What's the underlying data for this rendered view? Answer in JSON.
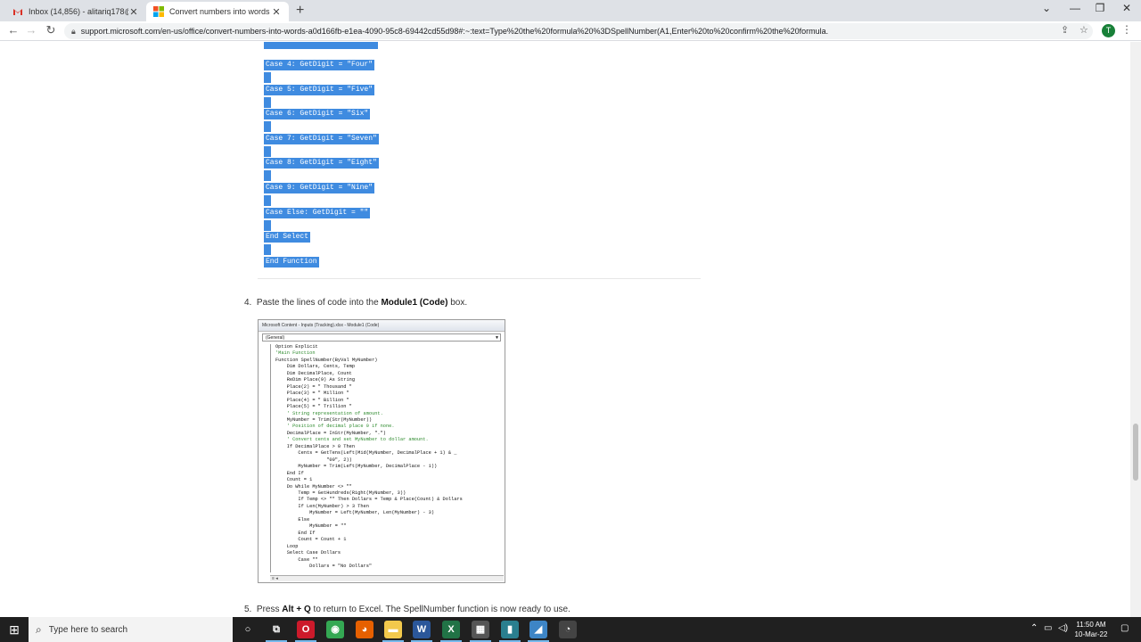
{
  "tabs": [
    {
      "title": "Inbox (14,856) - alitariq178@gm",
      "close": "✕",
      "favicon_color": "#d93025"
    },
    {
      "title": "Convert numbers into words",
      "close": "✕",
      "favicon_color": "#f25022"
    }
  ],
  "new_tab": "+",
  "window_controls": {
    "minimize": "—",
    "maximize": "❐",
    "close": "✕",
    "tab_search": "⌄"
  },
  "address_bar": {
    "url": "support.microsoft.com/en-us/office/convert-numbers-into-words-a0d166fb-e1ea-4090-95c8-69442cd55d98#:~:text=Type%20the%20formula%20%3DSpellNumber(A1,Enter%20to%20confirm%20the%20formula.",
    "profile_initial": "T"
  },
  "code_block": [
    {
      "text": "Case 4: GetDigit = \"Four\""
    },
    {
      "text": "Case 5: GetDigit = \"Five\""
    },
    {
      "text": "Case 6: GetDigit = \"Six\""
    },
    {
      "text": "Case 7: GetDigit = \"Seven\""
    },
    {
      "text": "Case 8: GetDigit = \"Eight\""
    },
    {
      "text": "Case 9: GetDigit = \"Nine\""
    },
    {
      "text": "Case Else: GetDigit = \"\""
    },
    {
      "text": "End Select"
    },
    {
      "text": "End Function"
    }
  ],
  "steps": {
    "step4": {
      "num": "4.",
      "before": "Paste the lines of code into the ",
      "bold": "Module1 (Code)",
      "after": " box."
    },
    "step5": {
      "num": "5.",
      "before": "Press ",
      "bold": "Alt + Q",
      "after": " to return to Excel. The SpellNumber function is now ready to use."
    }
  },
  "vba_window": {
    "title": "Microsoft Content - Inputs (Tracking).xlsx - Module1 (Code)",
    "combo": "(General)",
    "lines": [
      {
        "text": "Option Explicit",
        "comment": false
      },
      {
        "text": "'Main Function",
        "comment": true
      },
      {
        "text": "Function SpellNumber(ByVal MyNumber)",
        "comment": false
      },
      {
        "text": "    Dim Dollars, Cents, Temp",
        "comment": false
      },
      {
        "text": "    Dim DecimalPlace, Count",
        "comment": false
      },
      {
        "text": "    ReDim Place(9) As String",
        "comment": false
      },
      {
        "text": "    Place(2) = \" Thousand \"",
        "comment": false
      },
      {
        "text": "    Place(3) = \" Million \"",
        "comment": false
      },
      {
        "text": "    Place(4) = \" Billion \"",
        "comment": false
      },
      {
        "text": "    Place(5) = \" Trillion \"",
        "comment": false
      },
      {
        "text": "    ' String representation of amount.",
        "comment": true
      },
      {
        "text": "    MyNumber = Trim(Str(MyNumber))",
        "comment": false
      },
      {
        "text": "    ' Position of decimal place 0 if none.",
        "comment": true
      },
      {
        "text": "    DecimalPlace = InStr(MyNumber, \".\")",
        "comment": false
      },
      {
        "text": "    ' Convert cents and set MyNumber to dollar amount.",
        "comment": true
      },
      {
        "text": "    If DecimalPlace > 0 Then",
        "comment": false
      },
      {
        "text": "        Cents = GetTens(Left(Mid(MyNumber, DecimalPlace + 1) & _",
        "comment": false
      },
      {
        "text": "                  \"00\", 2))",
        "comment": false
      },
      {
        "text": "        MyNumber = Trim(Left(MyNumber, DecimalPlace - 1))",
        "comment": false
      },
      {
        "text": "    End If",
        "comment": false
      },
      {
        "text": "    Count = 1",
        "comment": false
      },
      {
        "text": "    Do While MyNumber <> \"\"",
        "comment": false
      },
      {
        "text": "        Temp = GetHundreds(Right(MyNumber, 3))",
        "comment": false
      },
      {
        "text": "        If Temp <> \"\" Then Dollars = Temp & Place(Count) & Dollars",
        "comment": false
      },
      {
        "text": "        If Len(MyNumber) > 3 Then",
        "comment": false
      },
      {
        "text": "            MyNumber = Left(MyNumber, Len(MyNumber) - 3)",
        "comment": false
      },
      {
        "text": "        Else",
        "comment": false
      },
      {
        "text": "            MyNumber = \"\"",
        "comment": false
      },
      {
        "text": "        End If",
        "comment": false
      },
      {
        "text": "        Count = Count + 1",
        "comment": false
      },
      {
        "text": "    Loop",
        "comment": false
      },
      {
        "text": "    Select Case Dollars",
        "comment": false
      },
      {
        "text": "        Case \"\"",
        "comment": false
      },
      {
        "text": "            Dollars = \"No Dollars\"",
        "comment": false
      }
    ]
  },
  "taskbar": {
    "search_placeholder": "Type here to search",
    "time": "11:50 AM",
    "date": "10-Mar-22",
    "apps": [
      {
        "name": "cortana",
        "glyph": "○",
        "color": "transparent"
      },
      {
        "name": "task-view",
        "glyph": "⧉",
        "color": "transparent"
      },
      {
        "name": "opera",
        "glyph": "O",
        "color": "#cc1a2b"
      },
      {
        "name": "chrome",
        "glyph": "◉",
        "color": "#34a853"
      },
      {
        "name": "firefox",
        "glyph": "◕",
        "color": "#e66000"
      },
      {
        "name": "file-explorer",
        "glyph": "▬",
        "color": "#f2c94c"
      },
      {
        "name": "word",
        "glyph": "W",
        "color": "#2b579a"
      },
      {
        "name": "excel",
        "glyph": "X",
        "color": "#217346"
      },
      {
        "name": "calculator",
        "glyph": "▦",
        "color": "#555555"
      },
      {
        "name": "vba-editor",
        "glyph": "▮",
        "color": "#2a7f8f"
      },
      {
        "name": "photos",
        "glyph": "◢",
        "color": "#3d85c6"
      },
      {
        "name": "screen-recorder",
        "glyph": "◔",
        "color": "#444444"
      }
    ]
  },
  "colors": {
    "selection": "#3f8be0",
    "taskbar": "#202020",
    "tab_bar": "#dee1e6"
  }
}
